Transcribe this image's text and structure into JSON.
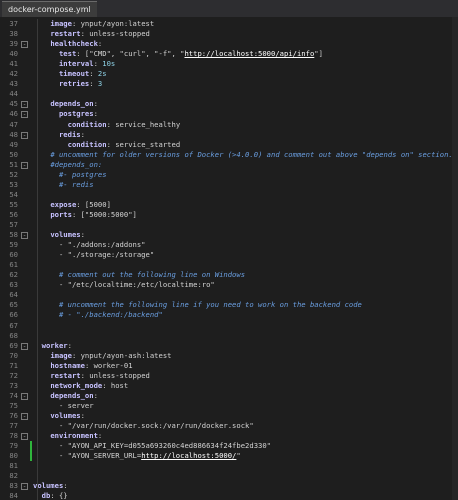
{
  "tab": {
    "title": "docker-compose.yml"
  },
  "lines": [
    {
      "n": "37",
      "indent": 4,
      "parts": [
        [
          "k",
          "image"
        ],
        [
          "s",
          ": ynput/ayon:latest"
        ]
      ]
    },
    {
      "n": "38",
      "indent": 4,
      "parts": [
        [
          "k",
          "restart"
        ],
        [
          "s",
          ": unless-stopped"
        ]
      ]
    },
    {
      "n": "39",
      "indent": 4,
      "parts": [
        [
          "k",
          "healthcheck"
        ],
        [
          "s",
          ":"
        ]
      ],
      "fold": "-"
    },
    {
      "n": "40",
      "indent": 6,
      "parts": [
        [
          "k",
          "test"
        ],
        [
          "s",
          ": [\"CMD\", \"curl\", \"-f\", \""
        ],
        [
          "u",
          "http://localhost:5000/api/info"
        ],
        [
          "s",
          "\"]"
        ]
      ]
    },
    {
      "n": "41",
      "indent": 6,
      "parts": [
        [
          "k",
          "interval"
        ],
        [
          "s",
          ": "
        ],
        [
          "n",
          "10s"
        ]
      ]
    },
    {
      "n": "42",
      "indent": 6,
      "parts": [
        [
          "k",
          "timeout"
        ],
        [
          "s",
          ": "
        ],
        [
          "n",
          "2s"
        ]
      ]
    },
    {
      "n": "43",
      "indent": 6,
      "parts": [
        [
          "k",
          "retries"
        ],
        [
          "s",
          ": "
        ],
        [
          "n",
          "3"
        ]
      ]
    },
    {
      "n": "44",
      "indent": 0,
      "parts": []
    },
    {
      "n": "45",
      "indent": 4,
      "parts": [
        [
          "k",
          "depends_on"
        ],
        [
          "s",
          ":"
        ]
      ],
      "fold": "-"
    },
    {
      "n": "46",
      "indent": 6,
      "parts": [
        [
          "k",
          "postgres"
        ],
        [
          "s",
          ":"
        ]
      ],
      "fold": "-"
    },
    {
      "n": "47",
      "indent": 8,
      "parts": [
        [
          "k",
          "condition"
        ],
        [
          "s",
          ": service_healthy"
        ]
      ]
    },
    {
      "n": "48",
      "indent": 6,
      "parts": [
        [
          "k",
          "redis"
        ],
        [
          "s",
          ":"
        ]
      ],
      "fold": "-"
    },
    {
      "n": "49",
      "indent": 8,
      "parts": [
        [
          "k",
          "condition"
        ],
        [
          "s",
          ": service_started"
        ]
      ]
    },
    {
      "n": "50",
      "indent": 4,
      "parts": [
        [
          "c",
          "# uncomment for older versions of Docker (>4.0.0) and comment out above \"depends on\" section."
        ]
      ]
    },
    {
      "n": "51",
      "indent": 4,
      "parts": [
        [
          "c",
          "#depends_on:"
        ]
      ],
      "fold": "-"
    },
    {
      "n": "52",
      "indent": 6,
      "parts": [
        [
          "c",
          "#- postgres"
        ]
      ]
    },
    {
      "n": "53",
      "indent": 6,
      "parts": [
        [
          "c",
          "#- redis"
        ]
      ]
    },
    {
      "n": "54",
      "indent": 0,
      "parts": []
    },
    {
      "n": "55",
      "indent": 4,
      "parts": [
        [
          "k",
          "expose"
        ],
        [
          "s",
          ": [5000]"
        ]
      ]
    },
    {
      "n": "56",
      "indent": 4,
      "parts": [
        [
          "k",
          "ports"
        ],
        [
          "s",
          ": [\"5000:5000\"]"
        ]
      ]
    },
    {
      "n": "57",
      "indent": 0,
      "parts": []
    },
    {
      "n": "58",
      "indent": 4,
      "parts": [
        [
          "k",
          "volumes"
        ],
        [
          "s",
          ":"
        ]
      ],
      "fold": "-"
    },
    {
      "n": "59",
      "indent": 6,
      "parts": [
        [
          "s",
          "- \"./addons:/addons\""
        ]
      ]
    },
    {
      "n": "60",
      "indent": 6,
      "parts": [
        [
          "s",
          "- \"./storage:/storage\""
        ]
      ]
    },
    {
      "n": "61",
      "indent": 0,
      "parts": []
    },
    {
      "n": "62",
      "indent": 6,
      "parts": [
        [
          "c",
          "# comment out the following line on Windows"
        ]
      ]
    },
    {
      "n": "63",
      "indent": 6,
      "parts": [
        [
          "s",
          "- \"/etc/localtime:/etc/localtime:ro\""
        ]
      ]
    },
    {
      "n": "64",
      "indent": 0,
      "parts": []
    },
    {
      "n": "65",
      "indent": 6,
      "parts": [
        [
          "c",
          "# uncomment the following line if you need to work on the backend code"
        ]
      ]
    },
    {
      "n": "66",
      "indent": 6,
      "parts": [
        [
          "c",
          "# - \"./backend:/backend\""
        ]
      ]
    },
    {
      "n": "67",
      "indent": 0,
      "parts": []
    },
    {
      "n": "68",
      "indent": 0,
      "parts": []
    },
    {
      "n": "69",
      "indent": 2,
      "parts": [
        [
          "k",
          "worker"
        ],
        [
          "s",
          ":"
        ]
      ],
      "fold": "-"
    },
    {
      "n": "70",
      "indent": 4,
      "parts": [
        [
          "k",
          "image"
        ],
        [
          "s",
          ": ynput/ayon-ash:latest"
        ]
      ]
    },
    {
      "n": "71",
      "indent": 4,
      "parts": [
        [
          "k",
          "hostname"
        ],
        [
          "s",
          ": worker-01"
        ]
      ]
    },
    {
      "n": "72",
      "indent": 4,
      "parts": [
        [
          "k",
          "restart"
        ],
        [
          "s",
          ": unless-stopped"
        ]
      ]
    },
    {
      "n": "73",
      "indent": 4,
      "parts": [
        [
          "k",
          "network_mode"
        ],
        [
          "s",
          ": host"
        ]
      ]
    },
    {
      "n": "74",
      "indent": 4,
      "parts": [
        [
          "k",
          "depends_on"
        ],
        [
          "s",
          ":"
        ]
      ],
      "fold": "-"
    },
    {
      "n": "75",
      "indent": 6,
      "parts": [
        [
          "s",
          "- server"
        ]
      ]
    },
    {
      "n": "76",
      "indent": 4,
      "parts": [
        [
          "k",
          "volumes"
        ],
        [
          "s",
          ":"
        ]
      ],
      "fold": "-"
    },
    {
      "n": "77",
      "indent": 6,
      "parts": [
        [
          "s",
          "- \"/var/run/docker.sock:/var/run/docker.sock\""
        ]
      ]
    },
    {
      "n": "78",
      "indent": 4,
      "parts": [
        [
          "k",
          "environment"
        ],
        [
          "s",
          ":"
        ]
      ],
      "fold": "-"
    },
    {
      "n": "79",
      "indent": 6,
      "parts": [
        [
          "s",
          "- \"AYON_API_KEY=d055a693260c4ed886634f24fbe2d330\""
        ]
      ],
      "changed": true
    },
    {
      "n": "80",
      "indent": 6,
      "parts": [
        [
          "s",
          "- \"AYON_SERVER_URL="
        ],
        [
          "u",
          "http://localhost:5000/"
        ],
        [
          "s",
          "\""
        ]
      ],
      "changed": true
    },
    {
      "n": "81",
      "indent": 0,
      "parts": []
    },
    {
      "n": "82",
      "indent": 0,
      "parts": []
    },
    {
      "n": "83",
      "indent": 0,
      "parts": [
        [
          "k",
          "volumes"
        ],
        [
          "s",
          ":"
        ]
      ],
      "fold": "-"
    },
    {
      "n": "84",
      "indent": 2,
      "parts": [
        [
          "k",
          "db"
        ],
        [
          "s",
          ": {}"
        ]
      ]
    }
  ]
}
